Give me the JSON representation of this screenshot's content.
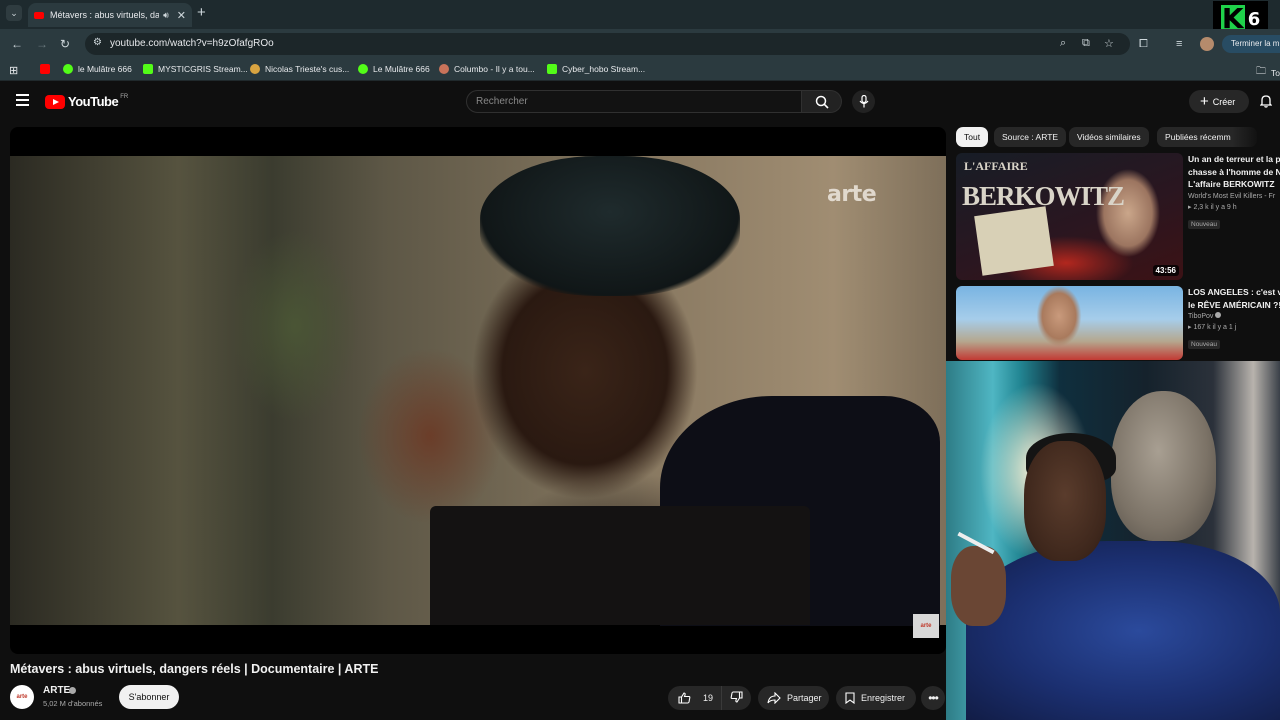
{
  "browser": {
    "tab_title": "Métavers : abus virtuels, da",
    "url": "youtube.com/watch?v=h9zOfafgROo",
    "end_session_label": "Terminer la m",
    "bookmarks": [
      {
        "label": "",
        "color": "#ff0000"
      },
      {
        "label": "le Mulâtre 666",
        "color": "#53fc18"
      },
      {
        "label": "MYSTICGRIS Stream...",
        "color": "#53fc18"
      },
      {
        "label": "Nicolas Trieste's cus...",
        "color": "#d9a441"
      },
      {
        "label": "Le Mulâtre 666",
        "color": "#53fc18"
      },
      {
        "label": "Columbo - Il y a tou...",
        "color": "#c9735a"
      },
      {
        "label": "Cyber_hobo Stream...",
        "color": "#53fc18"
      }
    ],
    "bookmarks_folder_label": "To"
  },
  "overlay_logo": {
    "letter": "K",
    "number": "6"
  },
  "youtube": {
    "logo_text": "YouTube",
    "country_code": "FR",
    "search_placeholder": "Rechercher",
    "create_label": "Créer"
  },
  "video": {
    "watermark": "arte",
    "corner_logo": "arte",
    "title": "Métavers : abus virtuels, dangers réels | Documentaire | ARTE",
    "channel_name": "ARTE",
    "channel_avatar_text": "arte",
    "subscribers": "5,02 M d'abonnés",
    "subscribe_label": "S'abonner",
    "like_count": "19",
    "share_label": "Partager",
    "save_label": "Enregistrer"
  },
  "chips": [
    "Tout",
    "Source : ARTE",
    "Vidéos similaires",
    "Publiées récemm"
  ],
  "recommendations": [
    {
      "title_line1": "Un an de terreur et la pl",
      "title_line2": "chasse à l'homme de N",
      "title_line3": "L'affaire BERKOWITZ",
      "channel": "World's Most Evil Killers - Fr",
      "stats": "2,3 k  il y a 9 h",
      "badge": "Nouveau",
      "duration": "43:56",
      "thumb_title": "BERKOWITZ",
      "thumb_subtitle": "L'AFFAIRE"
    },
    {
      "title_line1": "LOS ANGELES : c'est vra",
      "title_line2": "le RÊVE AMÉRICAIN ?!",
      "channel": "TiboPov",
      "stats": "167 k  il y a 1 j",
      "badge": "Nouveau"
    }
  ]
}
